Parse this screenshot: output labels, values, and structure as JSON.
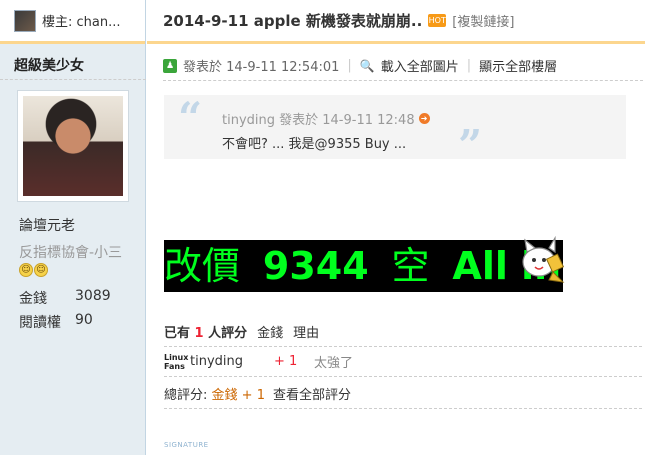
{
  "sidebar": {
    "floor_host_label": "樓主: chan...",
    "username": "超級美少女",
    "rank": "論壇元老",
    "custom_title": "反指標協會-小三",
    "smilies": [
      "smiley-icon",
      "smiley-icon"
    ],
    "stats": [
      {
        "key": "金錢",
        "value": "3089"
      },
      {
        "key": "閱讀權",
        "value": "90"
      }
    ]
  },
  "thread": {
    "title": "2014-9-11 apple 新機發表就崩崩..",
    "copy_link": "[複製鏈接]"
  },
  "post_meta": {
    "posted_label": "發表於 14-9-11 12:54:01",
    "load_images": "載入全部圖片",
    "separator": "|",
    "show_all_floors": "顯示全部樓層"
  },
  "quote": {
    "author_line": "tinyding 發表於  14-9-11 12:48",
    "text": "不會吧? ... 我是@9355 Buy ..."
  },
  "post_body": {
    "part1": "改價 ",
    "part2": "9344",
    "part3": " 空 ",
    "part4": "All in"
  },
  "rating": {
    "head_prefix": "已有",
    "head_count": "1",
    "head_suffix": "人評分",
    "col_money": "金錢",
    "col_reason": "理由",
    "rows": [
      {
        "logo": "Linux Fans",
        "name": "tinyding",
        "score": "+ 1",
        "reason": "太強了"
      }
    ],
    "total_label": "總評分:",
    "total_value": "金錢 + 1",
    "view_all": "查看全部評分"
  },
  "signature_label": "SIGNATURE",
  "colors": {
    "accent_line": "#fcd68e",
    "sidebar_bg": "#e5edf2",
    "score_red": "#ee2233",
    "highlight_green": "#00ff1e"
  }
}
